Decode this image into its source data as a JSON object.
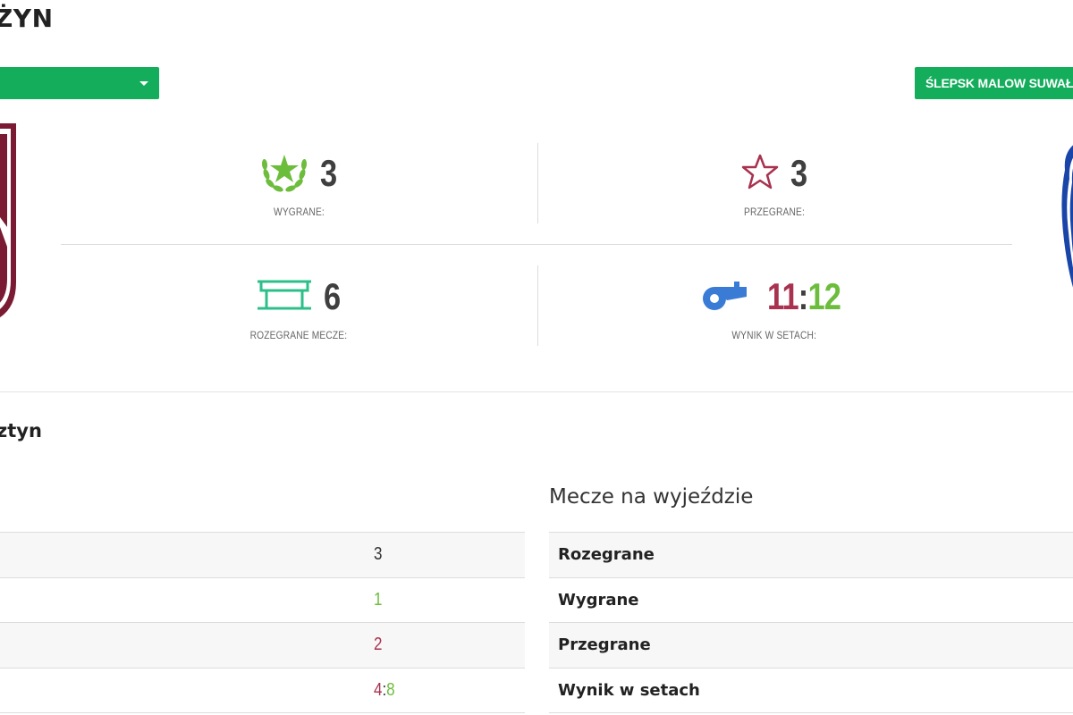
{
  "header": {
    "title": "ŻYN"
  },
  "selectors": {
    "team_select_value": "",
    "opponent_button_label": "ŚLEPSK MALOW SUWAŁKI"
  },
  "stats": {
    "wins": {
      "value": "3",
      "label": "WYGRANE:",
      "icon": "laurel-star-icon"
    },
    "losses": {
      "value": "3",
      "label": "PRZEGRANE:",
      "icon": "star-outline-icon"
    },
    "played": {
      "value": "6",
      "label": "ROZEGRANE MECZE:",
      "icon": "volleyball-net-icon"
    },
    "sets": {
      "home": "11",
      "separator": ":",
      "away": "12",
      "label": "WYNIK W SETACH:",
      "icon": "whistle-icon"
    }
  },
  "section": {
    "title": "ztyn"
  },
  "home_matches": {
    "rows": [
      {
        "value": "3"
      },
      {
        "value": "1"
      },
      {
        "value": "2"
      },
      {
        "sets_home": "4",
        "separator": ":",
        "sets_away": "8"
      }
    ]
  },
  "away_matches": {
    "title": "Mecze na wyjeździe",
    "rows": [
      {
        "label": "Rozegrane"
      },
      {
        "label": "Wygrane"
      },
      {
        "label": "Przegrane"
      },
      {
        "label": "Wynik w setach"
      }
    ]
  },
  "colors": {
    "accent_green": "#13ad5b",
    "win_green": "#6dbd3c",
    "loss_red": "#a8324f",
    "home_crest": "#7a1a33",
    "away_crest": "#1a45a8"
  }
}
